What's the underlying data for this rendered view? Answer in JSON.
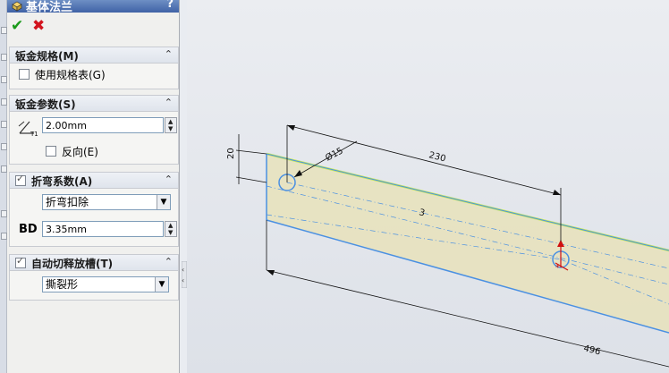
{
  "panel": {
    "title": "基体法兰",
    "help": "?",
    "ok_icon": "check-icon",
    "cancel_icon": "x-icon"
  },
  "groups": {
    "sheet_gauges": {
      "title": "钣金规格(M)",
      "use_gauge_table": {
        "label": "使用规格表(G)",
        "checked": false
      }
    },
    "sheet_params": {
      "title": "钣金参数(S)",
      "thickness": "2.00mm",
      "reverse": {
        "label": "反向(E)",
        "checked": false
      }
    },
    "bend_allowance": {
      "title": "折弯系数(A)",
      "enabled": true,
      "type": "折弯扣除",
      "bd_label": "BD",
      "bd_value": "3.35mm"
    },
    "auto_relief": {
      "title": "自动切释放槽(T)",
      "enabled": true,
      "type": "撕裂形"
    }
  },
  "drawing": {
    "dim_height": "20",
    "dim_hole": "Ø15",
    "dim_center": "230",
    "dim_length": "496",
    "sketch_label": "3"
  },
  "colors": {
    "titlebar": "#3f62a6",
    "sheet_fill": "#e8e2bb",
    "sheet_edge": "#4a90e2",
    "highlight": "#c7e85a"
  }
}
